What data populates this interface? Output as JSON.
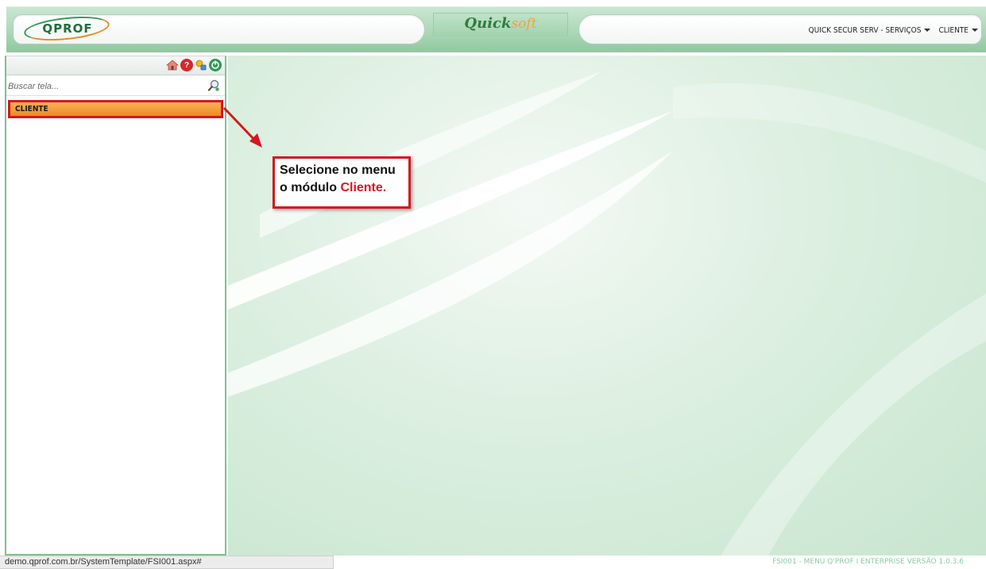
{
  "header": {
    "logo_text": "QPROF",
    "brand_quick": "Quick",
    "brand_soft": "soft",
    "nav": [
      {
        "label": "QUICK SECUR SERV - SERVIÇOS"
      },
      {
        "label": "CLIENTE"
      }
    ]
  },
  "sidebar": {
    "toolbar_icons": [
      "home-icon",
      "help-icon",
      "security-icon",
      "logout-icon"
    ],
    "search_placeholder": "Buscar tela...",
    "menu_items": [
      {
        "label": "CLIENTE",
        "selected": true
      }
    ]
  },
  "callout": {
    "line1": "Selecione no menu",
    "line2_prefix": "o módulo ",
    "line2_highlight": "Cliente."
  },
  "statusbar": {
    "url": "demo.qprof.com.br/SystemTemplate/FSI001.aspx#"
  },
  "footer": {
    "version": "FSI001 - MENU Q'PROF I ENTERPRISE VERSÃO 1.0.3.6"
  },
  "colors": {
    "accent_green": "#7fbf93",
    "highlight_red": "#d4181f",
    "menu_orange": "#ee8a22"
  }
}
